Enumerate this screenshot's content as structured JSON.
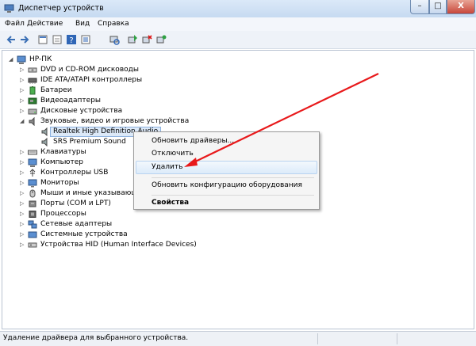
{
  "window": {
    "title": "Диспетчер устройств",
    "min": "–",
    "max": "□",
    "close": "X"
  },
  "menu": [
    "Файл",
    "Действие",
    "Вид",
    "Справка"
  ],
  "toolbar": [
    "back-icon",
    "forward-icon",
    "properties-icon",
    "refresh-icon",
    "help-icon",
    "scan-icon",
    "update-driver-icon",
    "disable-icon",
    "uninstall-icon"
  ],
  "tree": {
    "root": "HP-ПК",
    "items": [
      {
        "label": "DVD и CD-ROM дисководы",
        "icon": "dvd-icon"
      },
      {
        "label": "IDE ATA/ATAPI контроллеры",
        "icon": "ide-icon"
      },
      {
        "label": "Батареи",
        "icon": "battery-icon"
      },
      {
        "label": "Видеоадаптеры",
        "icon": "display-adapter-icon"
      },
      {
        "label": "Дисковые устройства",
        "icon": "disk-icon"
      },
      {
        "label": "Звуковые, видео и игровые устройства",
        "icon": "sound-icon",
        "expanded": true,
        "children": [
          "Realtek High Definition Audio",
          "SRS Premium Sound"
        ]
      },
      {
        "label": "Клавиатуры",
        "icon": "keyboard-icon"
      },
      {
        "label": "Компьютер",
        "icon": "computer-icon"
      },
      {
        "label": "Контроллеры USB",
        "icon": "usb-icon"
      },
      {
        "label": "Мониторы",
        "icon": "monitor-icon"
      },
      {
        "label": "Мыши и иные указывающие устройства",
        "icon": "mouse-icon"
      },
      {
        "label": "Порты (COM и LPT)",
        "icon": "port-icon"
      },
      {
        "label": "Процессоры",
        "icon": "cpu-icon"
      },
      {
        "label": "Сетевые адаптеры",
        "icon": "network-icon"
      },
      {
        "label": "Системные устройства",
        "icon": "system-icon"
      },
      {
        "label": "Устройства HID (Human Interface Devices)",
        "icon": "hid-icon"
      }
    ]
  },
  "context_menu": {
    "update": "Обновить драйверы...",
    "disable": "Отключить",
    "uninstall": "Удалить",
    "scan": "Обновить конфигурацию оборудования",
    "properties": "Свойства"
  },
  "status": {
    "text": "Удаление драйвера для выбранного устройства."
  },
  "colors": {
    "arrow": "#e8191b",
    "highlight": "#dcebfa"
  }
}
